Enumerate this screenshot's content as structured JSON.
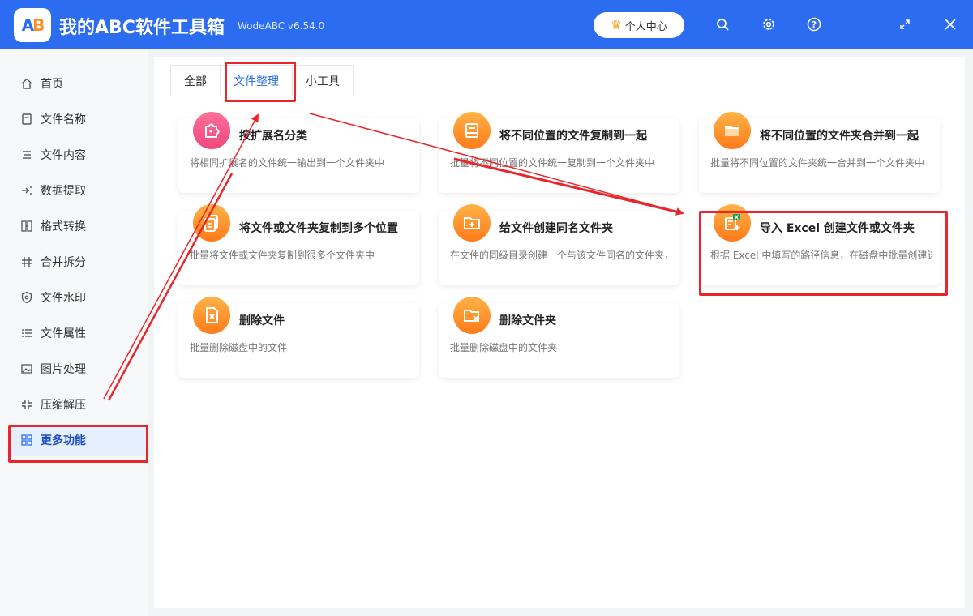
{
  "app": {
    "logo_text_a": "A",
    "logo_text_b": "B",
    "title": "我的ABC软件工具箱",
    "version": "WodeABC v6.54.0",
    "user_center": "个人中心"
  },
  "colors": {
    "brand": "#2b6cf0",
    "accent_orange": "#ff7a1a",
    "accent_pink": "#f0487c",
    "annotation_red": "#e8262b"
  },
  "sidebar": {
    "items": [
      {
        "label": "首页",
        "icon": "home-icon"
      },
      {
        "label": "文件名称",
        "icon": "file-name-icon"
      },
      {
        "label": "文件内容",
        "icon": "file-content-icon"
      },
      {
        "label": "数据提取",
        "icon": "data-extract-icon"
      },
      {
        "label": "格式转换",
        "icon": "format-convert-icon"
      },
      {
        "label": "合并拆分",
        "icon": "merge-split-icon"
      },
      {
        "label": "文件水印",
        "icon": "watermark-icon"
      },
      {
        "label": "文件属性",
        "icon": "file-attribute-icon"
      },
      {
        "label": "图片处理",
        "icon": "image-icon"
      },
      {
        "label": "压缩解压",
        "icon": "compress-icon"
      },
      {
        "label": "更多功能",
        "icon": "more-features-icon",
        "active": true
      }
    ]
  },
  "tabs": [
    {
      "label": "全部"
    },
    {
      "label": "文件整理",
      "active": true
    },
    {
      "label": "小工具"
    }
  ],
  "cards": [
    {
      "title": "按扩展名分类",
      "desc": "将相同扩展名的文件统一输出到一个文件夹中",
      "icon": "puzzle-icon"
    },
    {
      "title": "将不同位置的文件复制到一起",
      "desc": "批量将不同位置的文件统一复制到一个文件夹中",
      "icon": "tray-icon"
    },
    {
      "title": "将不同位置的文件夹合并到一起",
      "desc": "批量将不同位置的文件夹统一合并到一个文件夹中",
      "icon": "folder-icon"
    },
    {
      "title": "将文件或文件夹复制到多个位置",
      "desc": "批量将文件或文件夹复制到很多个文件夹中",
      "icon": "copy-icon"
    },
    {
      "title": "给文件创建同名文件夹",
      "desc": "在文件的同级目录创建一个与该文件同名的文件夹，",
      "icon": "folder-add-icon"
    },
    {
      "title": "导入 Excel 创建文件或文件夹",
      "desc": "根据 Excel 中填写的路径信息，在磁盘中批量创建该",
      "icon": "excel-import-icon"
    },
    {
      "title": "删除文件",
      "desc": "批量删除磁盘中的文件",
      "icon": "file-delete-icon"
    },
    {
      "title": "删除文件夹",
      "desc": "批量删除磁盘中的文件夹",
      "icon": "folder-delete-icon"
    }
  ]
}
